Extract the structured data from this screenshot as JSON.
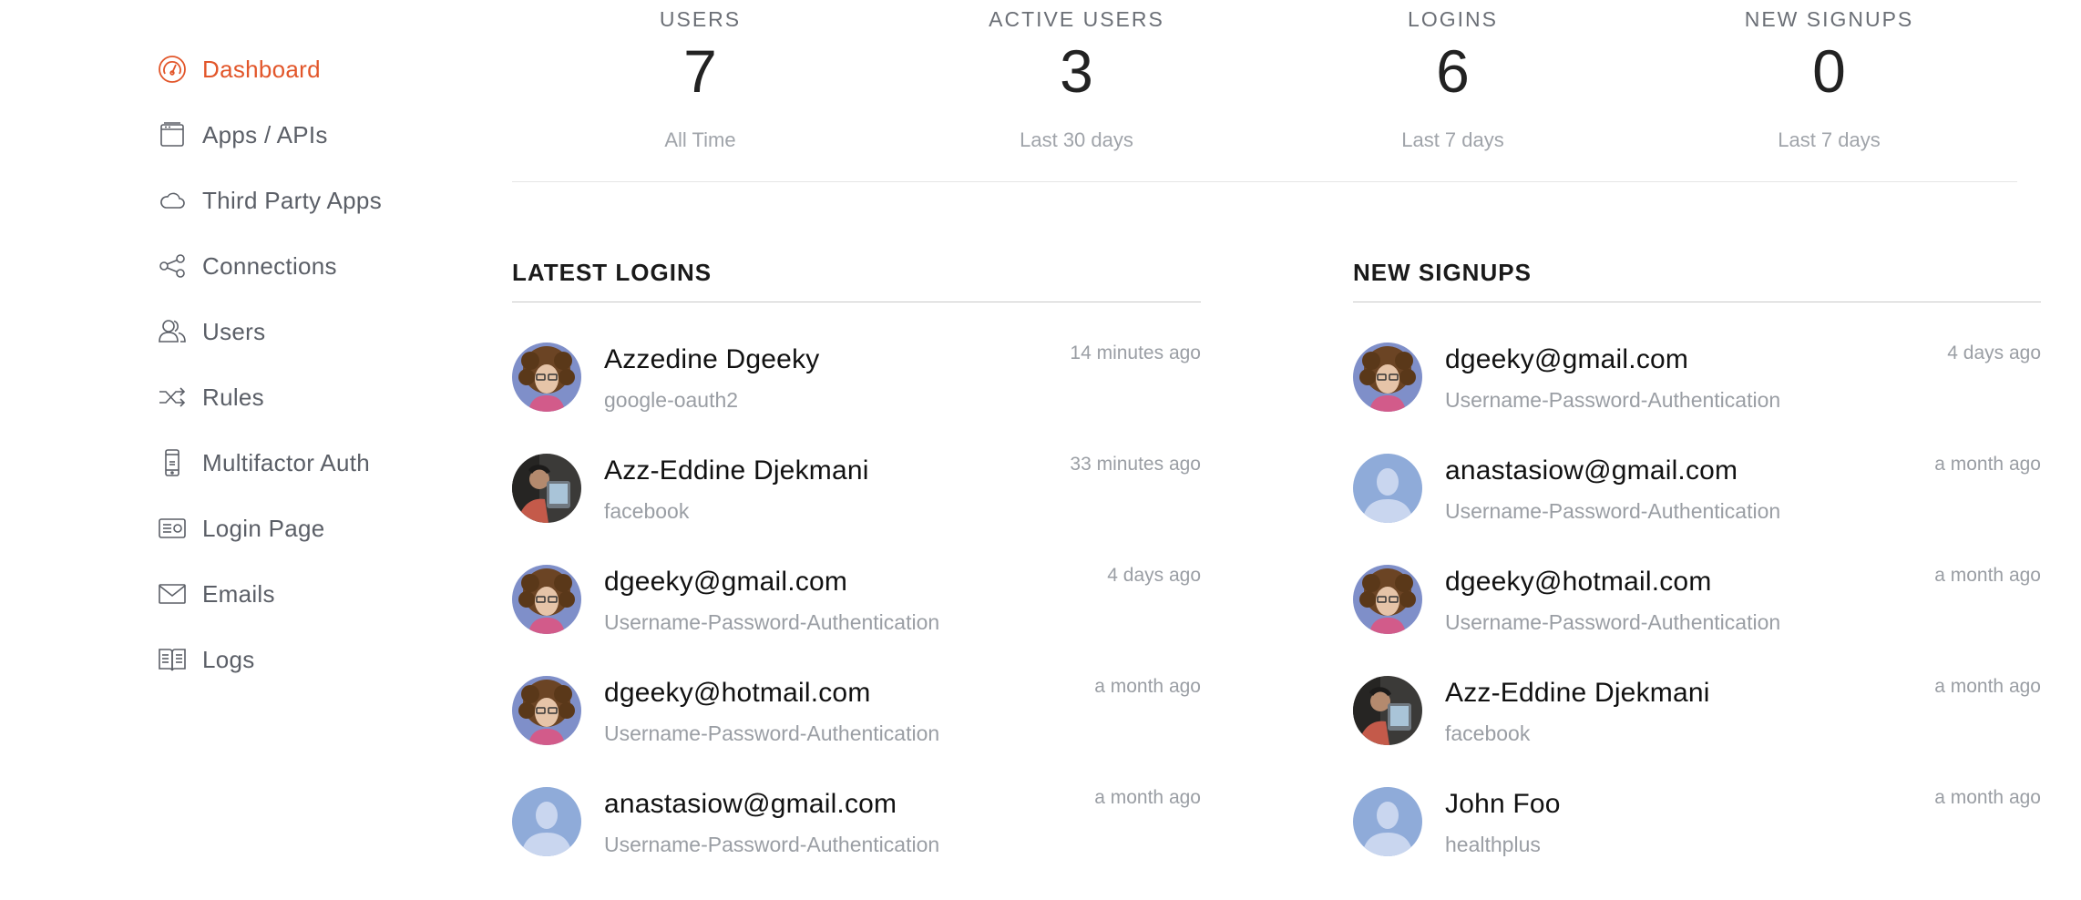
{
  "sidebar": {
    "items": [
      {
        "label": "Dashboard",
        "icon": "dashboard-icon",
        "active": true
      },
      {
        "label": "Apps / APIs",
        "icon": "apps-icon"
      },
      {
        "label": "Third Party Apps",
        "icon": "cloud-icon"
      },
      {
        "label": "Connections",
        "icon": "connections-icon"
      },
      {
        "label": "Users",
        "icon": "users-icon"
      },
      {
        "label": "Rules",
        "icon": "shuffle-icon"
      },
      {
        "label": "Multifactor Auth",
        "icon": "phone-icon"
      },
      {
        "label": "Login Page",
        "icon": "id-card-icon"
      },
      {
        "label": "Emails",
        "icon": "envelope-icon"
      },
      {
        "label": "Logs",
        "icon": "book-icon"
      }
    ]
  },
  "stats": [
    {
      "label": "USERS",
      "value": "7",
      "sub": "All Time"
    },
    {
      "label": "ACTIVE USERS",
      "value": "3",
      "sub": "Last 30 days"
    },
    {
      "label": "LOGINS",
      "value": "6",
      "sub": "Last 7 days"
    },
    {
      "label": "NEW SIGNUPS",
      "value": "0",
      "sub": "Last 7 days"
    }
  ],
  "latest_logins": {
    "title": "LATEST LOGINS",
    "rows": [
      {
        "name": "Azzedine Dgeeky",
        "sub": "google-oauth2",
        "time": "14 minutes ago",
        "avatar": "curly-hair-avatar"
      },
      {
        "name": "Azz-Eddine Djekmani",
        "sub": "facebook",
        "time": "33 minutes ago",
        "avatar": "photo-avatar"
      },
      {
        "name": "dgeeky@gmail.com",
        "sub": "Username-Password-Authentication",
        "time": "4 days ago",
        "avatar": "curly-hair-avatar"
      },
      {
        "name": "dgeeky@hotmail.com",
        "sub": "Username-Password-Authentication",
        "time": "a month ago",
        "avatar": "curly-hair-avatar"
      },
      {
        "name": "anastasiow@gmail.com",
        "sub": "Username-Password-Authentication",
        "time": "a month ago",
        "avatar": "default-avatar"
      }
    ]
  },
  "new_signups": {
    "title": "NEW SIGNUPS",
    "rows": [
      {
        "name": "dgeeky@gmail.com",
        "sub": "Username-Password-Authentication",
        "time": "4 days ago",
        "avatar": "curly-hair-avatar"
      },
      {
        "name": "anastasiow@gmail.com",
        "sub": "Username-Password-Authentication",
        "time": "a month ago",
        "avatar": "default-avatar"
      },
      {
        "name": "dgeeky@hotmail.com",
        "sub": "Username-Password-Authentication",
        "time": "a month ago",
        "avatar": "curly-hair-avatar"
      },
      {
        "name": "Azz-Eddine Djekmani",
        "sub": "facebook",
        "time": "a month ago",
        "avatar": "photo-avatar"
      },
      {
        "name": "John Foo",
        "sub": "healthplus",
        "time": "a month ago",
        "avatar": "default-avatar"
      }
    ]
  },
  "colors": {
    "accent": "#e2562a",
    "text": "#222222",
    "muted": "#9a9ea4"
  }
}
